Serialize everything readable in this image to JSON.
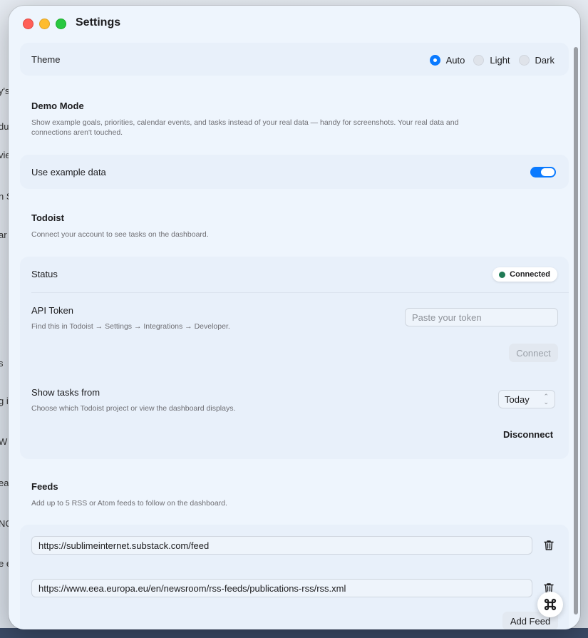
{
  "window": {
    "title": "Settings"
  },
  "theme": {
    "label": "Theme",
    "options": [
      {
        "label": "Auto",
        "selected": true
      },
      {
        "label": "Light",
        "selected": false
      },
      {
        "label": "Dark",
        "selected": false
      }
    ]
  },
  "demo": {
    "title": "Demo Mode",
    "description_line1": "Show example goals, priorities, calendar events, and tasks instead of your real data — handy for screenshots. Your real data and",
    "description_line2": "connections aren't touched.",
    "toggle_label": "Use example data",
    "toggle_on": true
  },
  "todoist": {
    "title": "Todoist",
    "description": "Connect your account to see tasks on the dashboard.",
    "status_label": "Status",
    "status_value": "Connected",
    "status_color": "#1f7a55",
    "token_label": "API Token",
    "token_hint": "Find this in Todoist → Settings → Integrations → Developer.",
    "token_placeholder": "Paste your token",
    "connect_label": "Connect",
    "show_tasks_label": "Show tasks from",
    "show_tasks_hint": "Choose which Todoist project or view the dashboard displays.",
    "show_tasks_value": "Today",
    "disconnect_label": "Disconnect"
  },
  "feeds": {
    "title": "Feeds",
    "description": "Add up to 5 RSS or Atom feeds to follow on the dashboard.",
    "items": [
      "https://sublimeinternet.substack.com/feed",
      "https://www.eea.europa.eu/en/newsroom/rss-feeds/publications-rss/rss.xml"
    ],
    "add_label": "Add Feed"
  },
  "colors": {
    "accent": "#0a7aff"
  }
}
